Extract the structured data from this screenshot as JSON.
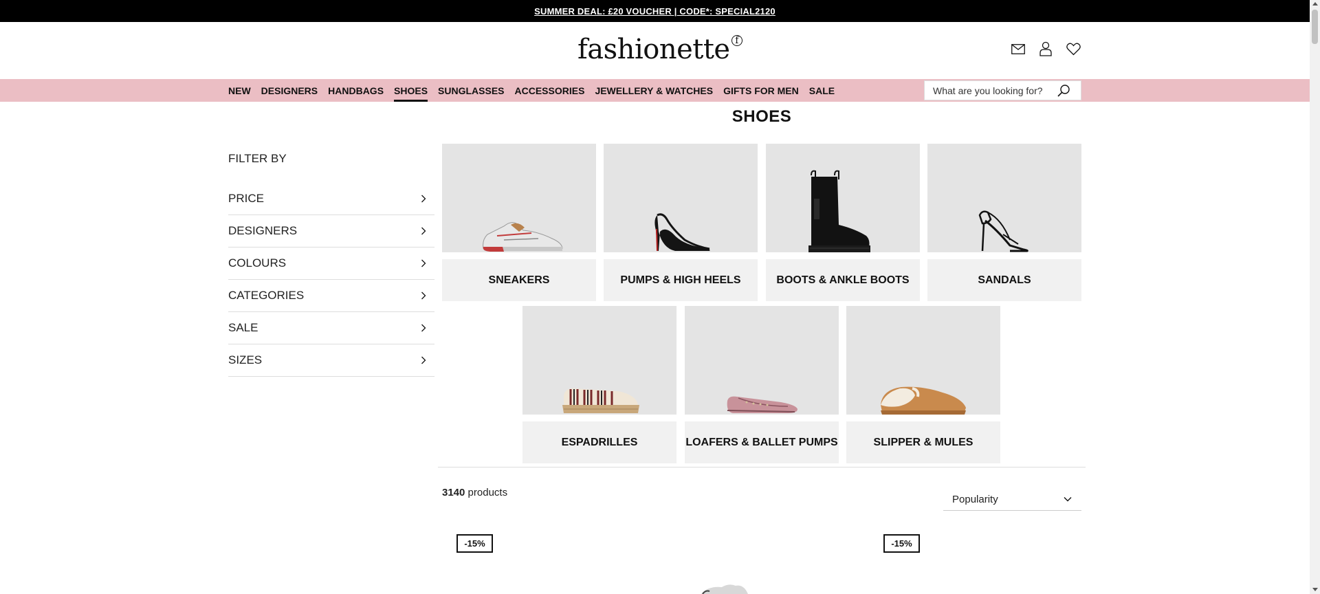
{
  "promo": {
    "text": "SUMMER DEAL: £20 VOUCHER | CODE*: SPECIAL2120"
  },
  "header": {
    "logo": "fashionette",
    "logo_mark": "f"
  },
  "nav": {
    "items": [
      {
        "label": "NEW"
      },
      {
        "label": "DESIGNERS"
      },
      {
        "label": "HANDBAGS"
      },
      {
        "label": "SHOES",
        "active": true
      },
      {
        "label": "SUNGLASSES"
      },
      {
        "label": "ACCESSORIES"
      },
      {
        "label": "JEWELLERY & WATCHES"
      },
      {
        "label": "GIFTS FOR MEN"
      },
      {
        "label": "SALE"
      }
    ]
  },
  "search": {
    "placeholder": "What are you looking for?"
  },
  "page": {
    "title": "SHOES"
  },
  "filters": {
    "title": "FILTER BY",
    "items": [
      {
        "label": "PRICE"
      },
      {
        "label": "DESIGNERS"
      },
      {
        "label": "COLOURS"
      },
      {
        "label": "CATEGORIES"
      },
      {
        "label": "SALE"
      },
      {
        "label": "SIZES"
      }
    ]
  },
  "categories": [
    {
      "label": "SNEAKERS"
    },
    {
      "label": "PUMPS & HIGH HEELS"
    },
    {
      "label": "BOOTS & ANKLE BOOTS"
    },
    {
      "label": "SANDALS"
    },
    {
      "label": "ESPADRILLES"
    },
    {
      "label": "LOAFERS & BALLET PUMPS"
    },
    {
      "label": "SLIPPER & MULES"
    }
  ],
  "results": {
    "count": "3140",
    "count_suffix": "products"
  },
  "sort": {
    "selected": "Popularity"
  },
  "products": [
    {
      "discount": "-15%"
    },
    {
      "discount": "-15%"
    }
  ],
  "colors": {
    "nav_bg": "#ebbec4",
    "promo_bg": "#000000",
    "tile_bg": "#ececec"
  }
}
